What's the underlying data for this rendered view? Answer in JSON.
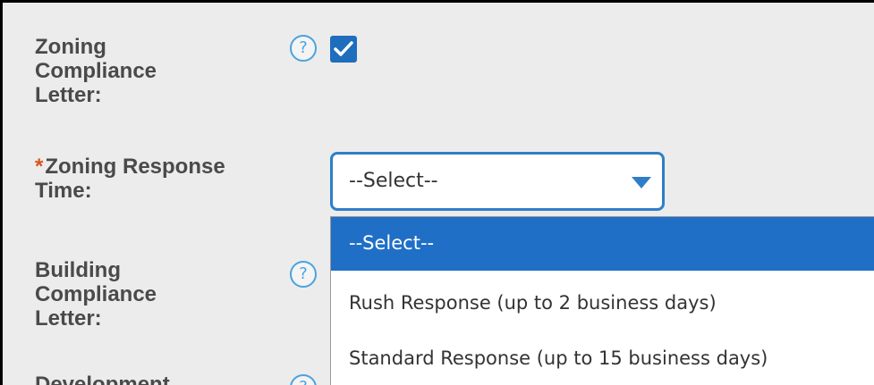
{
  "form": {
    "zoning_letter": {
      "label_line1": "Zoning",
      "label_line2": "Compliance",
      "label_line3": "Letter:",
      "help_glyph": "?",
      "checked": true
    },
    "response_time": {
      "required_mark": "*",
      "label_line1": "Zoning Response",
      "label_line2": "Time:",
      "selected": "--Select--",
      "options": [
        "--Select--",
        "Rush Response (up to 2 business days)",
        "Standard Response (up to 15 business days)"
      ]
    },
    "building_letter": {
      "label_line1": "Building",
      "label_line2": "Compliance",
      "label_line3": "Letter:",
      "help_glyph": "?"
    },
    "development": {
      "label_line1": "Development",
      "help_glyph": "?"
    }
  },
  "colors": {
    "accent": "#1f6fc6",
    "help": "#4aa3df",
    "required": "#d9531e",
    "label": "#4a4a4a"
  },
  "icons": {
    "help": "question-circle-icon",
    "check": "checkmark-icon",
    "dropdown": "caret-down-icon"
  }
}
